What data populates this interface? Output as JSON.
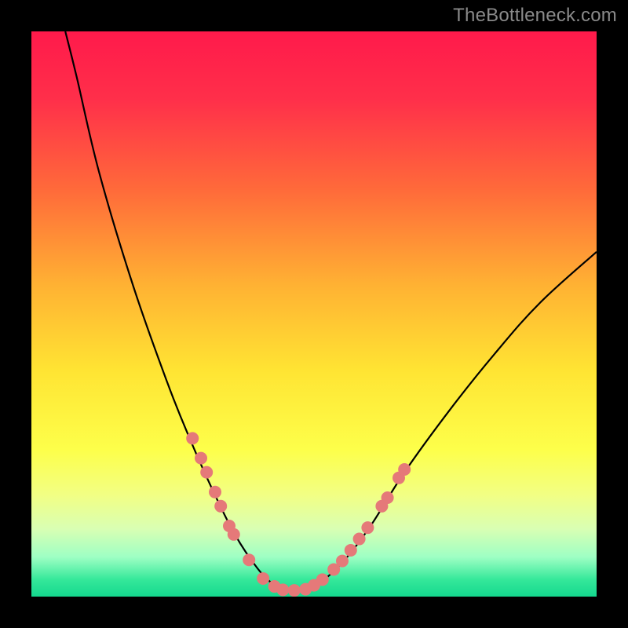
{
  "watermark": "TheBottleneck.com",
  "chart_data": {
    "type": "line",
    "title": "",
    "xlabel": "",
    "ylabel": "",
    "xlim": [
      0,
      100
    ],
    "ylim": [
      0,
      100
    ],
    "grid": false,
    "legend": false,
    "background_gradient_stops": [
      {
        "pos": 0.0,
        "color": "#ff1a4b"
      },
      {
        "pos": 0.12,
        "color": "#ff2f4a"
      },
      {
        "pos": 0.28,
        "color": "#ff6a3a"
      },
      {
        "pos": 0.45,
        "color": "#ffb233"
      },
      {
        "pos": 0.6,
        "color": "#ffe433"
      },
      {
        "pos": 0.74,
        "color": "#fdff4a"
      },
      {
        "pos": 0.82,
        "color": "#f2ff84"
      },
      {
        "pos": 0.88,
        "color": "#d9ffb3"
      },
      {
        "pos": 0.93,
        "color": "#9effc4"
      },
      {
        "pos": 0.97,
        "color": "#35e89a"
      },
      {
        "pos": 1.0,
        "color": "#14d88e"
      }
    ],
    "curve_left": {
      "description": "Left descending branch of V-curve",
      "points": [
        {
          "x": 6.0,
          "y": 100.0
        },
        {
          "x": 8.0,
          "y": 92.0
        },
        {
          "x": 12.0,
          "y": 75.0
        },
        {
          "x": 18.0,
          "y": 55.0
        },
        {
          "x": 24.0,
          "y": 38.0
        },
        {
          "x": 28.0,
          "y": 28.0
        },
        {
          "x": 32.0,
          "y": 19.0
        },
        {
          "x": 36.0,
          "y": 11.0
        },
        {
          "x": 40.0,
          "y": 5.0
        },
        {
          "x": 43.0,
          "y": 2.0
        },
        {
          "x": 45.0,
          "y": 1.0
        }
      ]
    },
    "curve_right": {
      "description": "Right ascending branch of V-curve",
      "points": [
        {
          "x": 45.0,
          "y": 1.0
        },
        {
          "x": 48.0,
          "y": 1.2
        },
        {
          "x": 51.0,
          "y": 2.5
        },
        {
          "x": 55.0,
          "y": 6.0
        },
        {
          "x": 60.0,
          "y": 12.5
        },
        {
          "x": 66.0,
          "y": 22.0
        },
        {
          "x": 74.0,
          "y": 33.0
        },
        {
          "x": 82.0,
          "y": 43.0
        },
        {
          "x": 90.0,
          "y": 52.0
        },
        {
          "x": 100.0,
          "y": 61.0
        }
      ]
    },
    "marker_color": "#e57979",
    "markers": [
      {
        "x": 28.5,
        "y": 28.0
      },
      {
        "x": 30.0,
        "y": 24.5
      },
      {
        "x": 31.0,
        "y": 22.0
      },
      {
        "x": 32.5,
        "y": 18.5
      },
      {
        "x": 33.5,
        "y": 16.0
      },
      {
        "x": 35.0,
        "y": 12.5
      },
      {
        "x": 35.8,
        "y": 11.0
      },
      {
        "x": 38.5,
        "y": 6.5
      },
      {
        "x": 41.0,
        "y": 3.2
      },
      {
        "x": 43.0,
        "y": 1.8
      },
      {
        "x": 44.5,
        "y": 1.2
      },
      {
        "x": 46.5,
        "y": 1.1
      },
      {
        "x": 48.5,
        "y": 1.3
      },
      {
        "x": 50.0,
        "y": 2.0
      },
      {
        "x": 51.5,
        "y": 3.0
      },
      {
        "x": 53.5,
        "y": 4.8
      },
      {
        "x": 55.0,
        "y": 6.3
      },
      {
        "x": 56.5,
        "y": 8.2
      },
      {
        "x": 58.0,
        "y": 10.2
      },
      {
        "x": 59.5,
        "y": 12.2
      },
      {
        "x": 62.0,
        "y": 16.0
      },
      {
        "x": 63.0,
        "y": 17.5
      },
      {
        "x": 65.0,
        "y": 21.0
      },
      {
        "x": 66.0,
        "y": 22.5
      }
    ]
  }
}
